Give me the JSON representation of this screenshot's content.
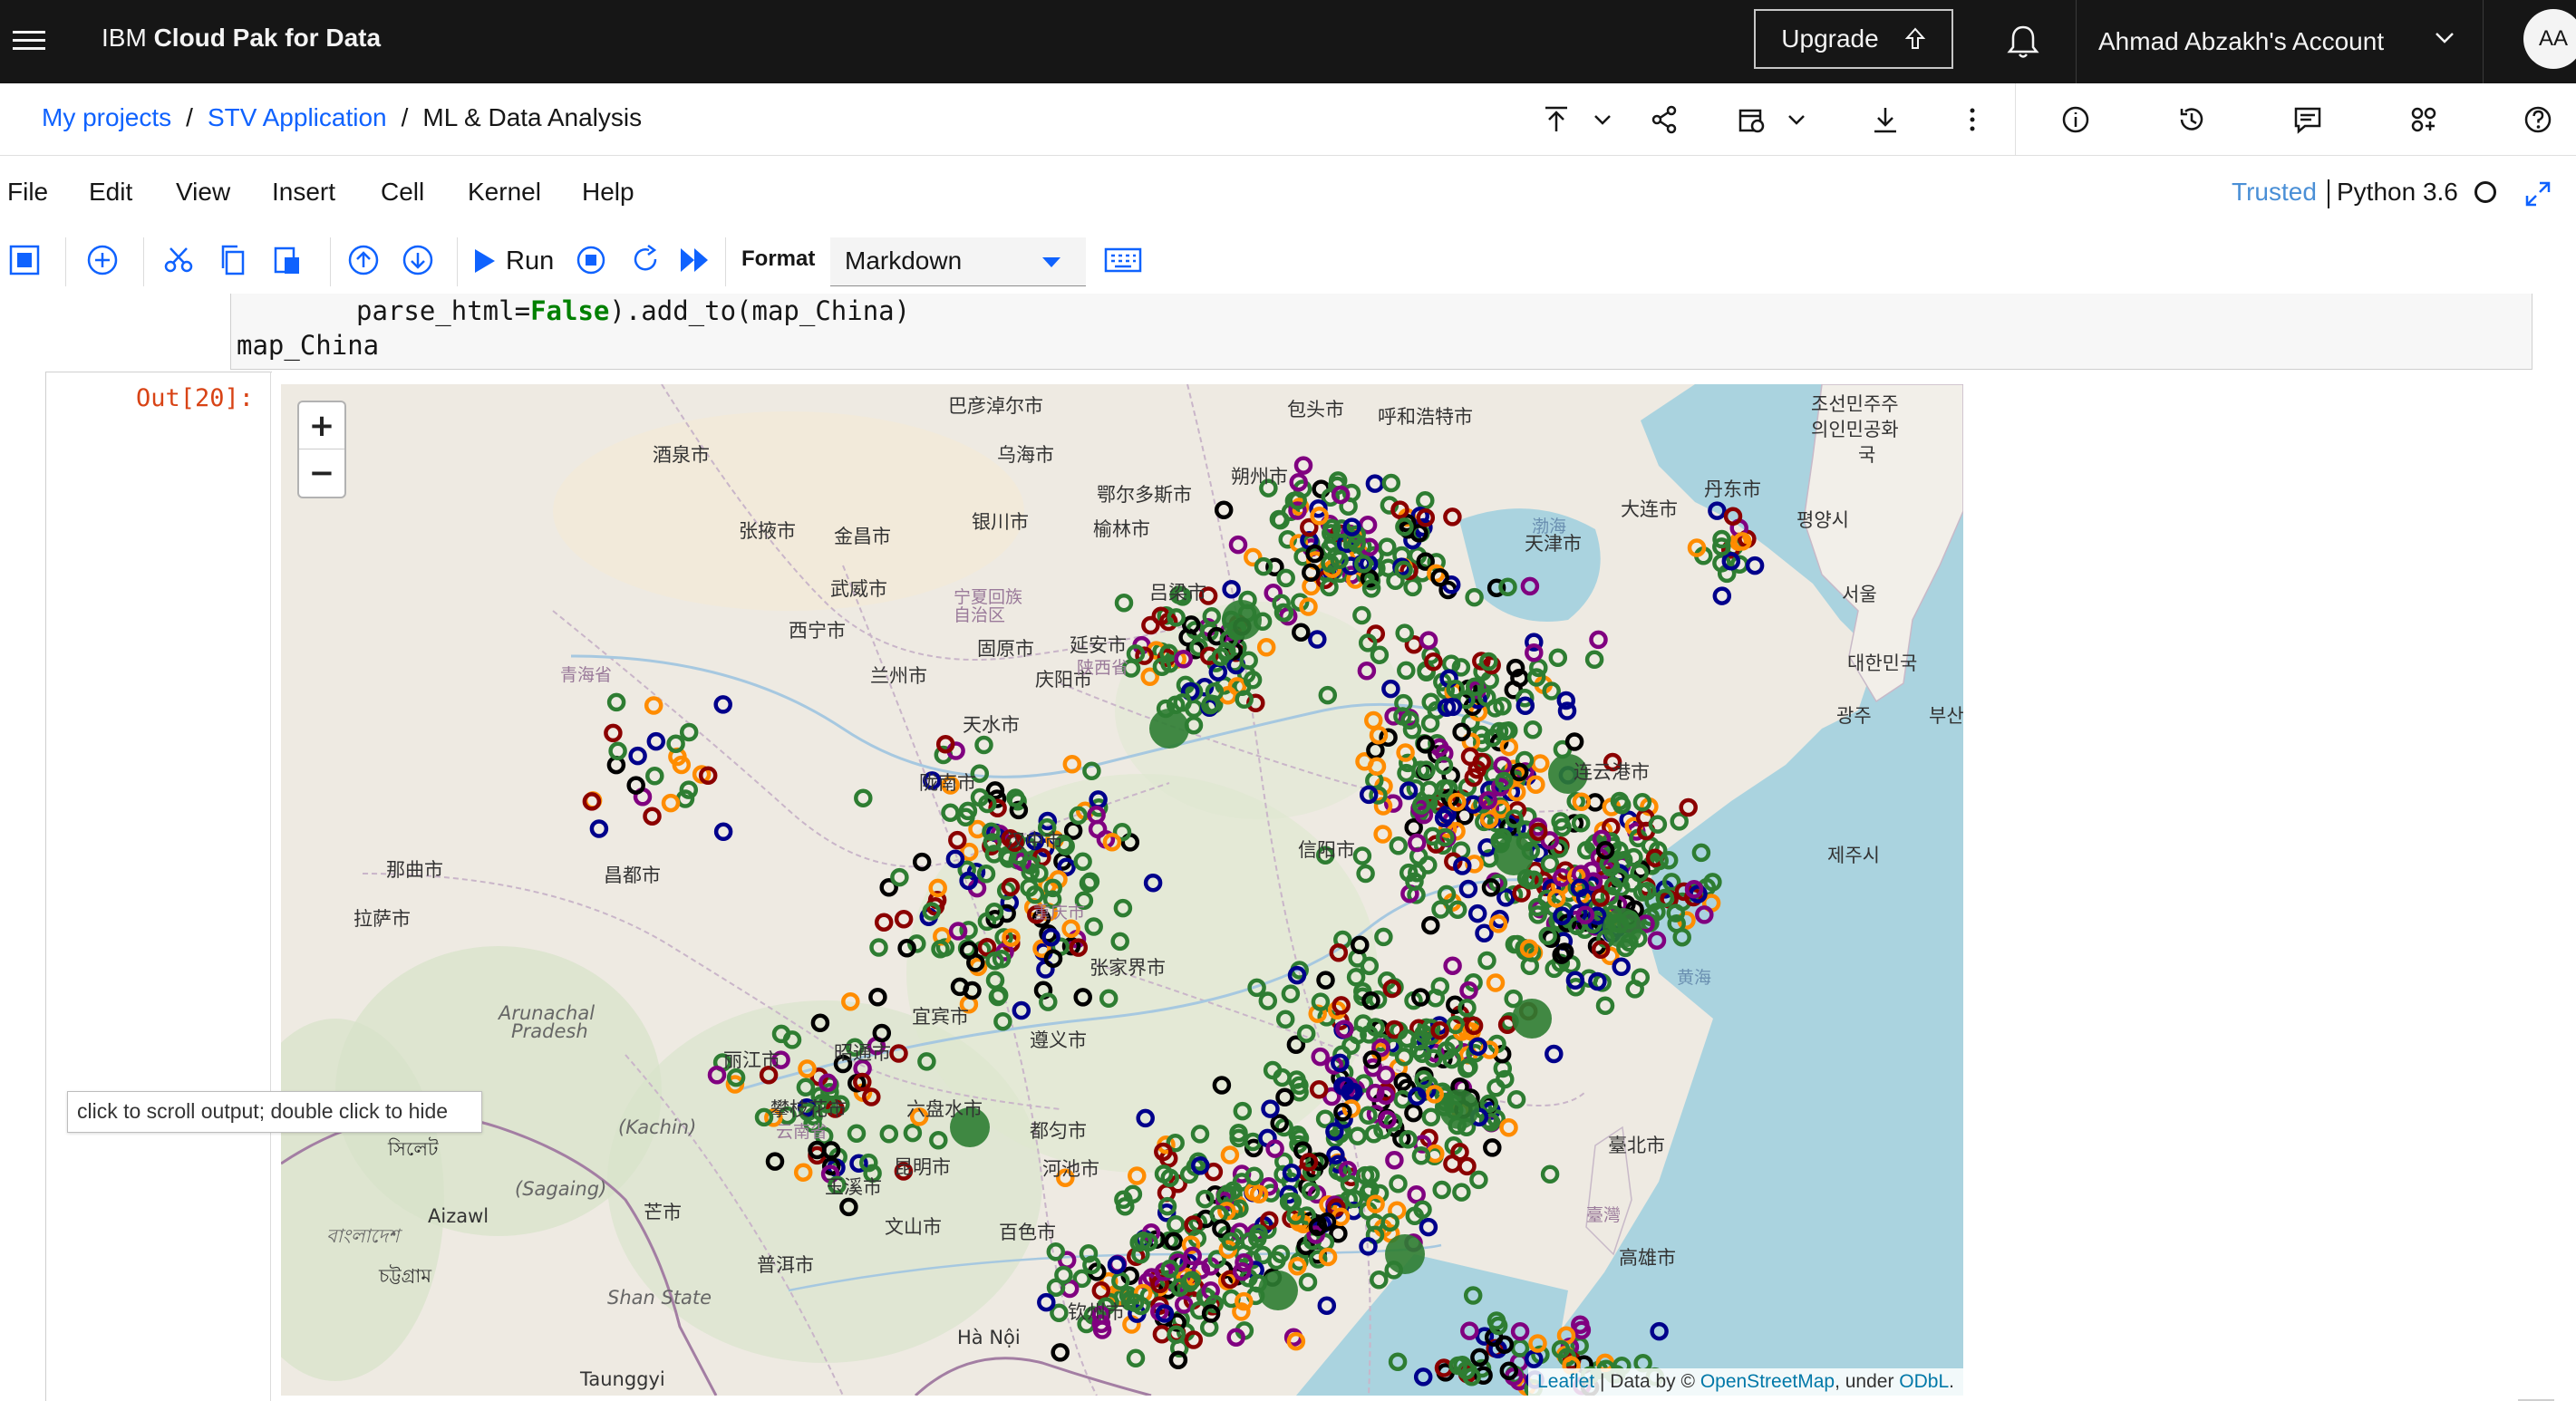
{
  "topbar": {
    "brand_prefix": "IBM ",
    "brand_bold": "Cloud Pak for Data",
    "upgrade_label": "Upgrade",
    "account_label": "Ahmad Abzakh's Account",
    "avatar_initials": "AA"
  },
  "breadcrumb": {
    "items": [
      "My projects",
      "STV Application"
    ],
    "current": "ML & Data Analysis",
    "separator": "/"
  },
  "menubar": {
    "items": [
      "File",
      "Edit",
      "View",
      "Insert",
      "Cell",
      "Kernel",
      "Help"
    ],
    "trusted_label": "Trusted",
    "kernel_label": "Python 3.6"
  },
  "toolbar": {
    "run_label": "Run",
    "format_label": "Format",
    "format_value": "Markdown"
  },
  "code": {
    "line1_a": "parse_html=",
    "line1_kw": "False",
    "line1_b": ").add_to(map_China)",
    "line2": "map_China"
  },
  "output": {
    "prompt": "Out[20]:",
    "tooltip": "click to scroll output; double click to hide"
  },
  "map": {
    "zoom_in": "+",
    "zoom_out": "−",
    "attribution_leaflet": "Leaflet",
    "attribution_mid": " | Data by © ",
    "attribution_osm": "OpenStreetMap",
    "attribution_under": ", under ",
    "attribution_odbl": "ODbL",
    "attribution_end": ".",
    "labels": [
      {
        "text": "巴彦淖尔市",
        "cls": ""
      },
      {
        "text": "包头市",
        "cls": ""
      },
      {
        "text": "呼和浩特市",
        "cls": ""
      },
      {
        "text": "乌海市",
        "cls": ""
      },
      {
        "text": "酒泉市",
        "cls": ""
      },
      {
        "text": "鄂尔多斯市",
        "cls": ""
      },
      {
        "text": "朔州市",
        "cls": ""
      },
      {
        "text": "张掖市",
        "cls": ""
      },
      {
        "text": "金昌市",
        "cls": ""
      },
      {
        "text": "银川市",
        "cls": ""
      },
      {
        "text": "榆林市",
        "cls": ""
      },
      {
        "text": "武威市",
        "cls": ""
      },
      {
        "text": "宁夏回族",
        "cls": "prov"
      },
      {
        "text": "自治区",
        "cls": "prov"
      },
      {
        "text": "吕梁市",
        "cls": ""
      },
      {
        "text": "西宁市",
        "cls": ""
      },
      {
        "text": "固原市",
        "cls": ""
      },
      {
        "text": "延安市",
        "cls": ""
      },
      {
        "text": "青海省",
        "cls": "prov"
      },
      {
        "text": "兰州市",
        "cls": ""
      },
      {
        "text": "庆阳市",
        "cls": ""
      },
      {
        "text": "陕西省",
        "cls": "prov"
      },
      {
        "text": "天水市",
        "cls": ""
      },
      {
        "text": "陇南市",
        "cls": ""
      },
      {
        "text": "汉中市",
        "cls": ""
      },
      {
        "text": "信阳市",
        "cls": ""
      },
      {
        "text": "那曲市",
        "cls": ""
      },
      {
        "text": "昌都市",
        "cls": ""
      },
      {
        "text": "拉萨市",
        "cls": ""
      },
      {
        "text": "重庆市",
        "cls": "prov"
      },
      {
        "text": "张家界市",
        "cls": ""
      },
      {
        "text": "宜宾市",
        "cls": ""
      },
      {
        "text": "遵义市",
        "cls": ""
      },
      {
        "text": "丽江市",
        "cls": ""
      },
      {
        "text": "昭通市",
        "cls": ""
      },
      {
        "text": "攀枝花市",
        "cls": ""
      },
      {
        "text": "六盘水市",
        "cls": ""
      },
      {
        "text": "都匀市",
        "cls": ""
      },
      {
        "text": "云南省",
        "cls": "prov"
      },
      {
        "text": "昆明市",
        "cls": ""
      },
      {
        "text": "河池市",
        "cls": ""
      },
      {
        "text": "玉溪市",
        "cls": ""
      },
      {
        "text": "文山市",
        "cls": ""
      },
      {
        "text": "百色市",
        "cls": ""
      },
      {
        "text": "普洱市",
        "cls": ""
      },
      {
        "text": "钦州市",
        "cls": ""
      },
      {
        "text": "Hà Nội",
        "cls": ""
      },
      {
        "text": "连云港市",
        "cls": ""
      },
      {
        "text": "天津市",
        "cls": ""
      },
      {
        "text": "大连市",
        "cls": ""
      },
      {
        "text": "丹东市",
        "cls": ""
      },
      {
        "text": "渤海",
        "cls": "sea"
      },
      {
        "text": "黄海",
        "cls": "sea"
      },
      {
        "text": "臺北市",
        "cls": ""
      },
      {
        "text": "臺灣",
        "cls": "prov"
      },
      {
        "text": "高雄市",
        "cls": ""
      },
      {
        "text": "조선민주주",
        "cls": ""
      },
      {
        "text": "의인민공화",
        "cls": ""
      },
      {
        "text": "국",
        "cls": ""
      },
      {
        "text": "평양시",
        "cls": ""
      },
      {
        "text": "서울",
        "cls": ""
      },
      {
        "text": "대한민국",
        "cls": ""
      },
      {
        "text": "광주",
        "cls": ""
      },
      {
        "text": "부산",
        "cls": ""
      },
      {
        "text": "제주시",
        "cls": ""
      },
      {
        "text": "Arunachal",
        "cls": "it"
      },
      {
        "text": "Pradesh",
        "cls": "it"
      },
      {
        "text": "(Kachin)",
        "cls": "it"
      },
      {
        "text": "(Sagaing)",
        "cls": "it"
      },
      {
        "text": "Shan State",
        "cls": "it"
      },
      {
        "text": "Aizawl",
        "cls": ""
      },
      {
        "text": "Taunggyi",
        "cls": ""
      },
      {
        "text": "সিলেট",
        "cls": ""
      },
      {
        "text": "বাংলাদেশ",
        "cls": "it"
      },
      {
        "text": "চট্টগ্রাম",
        "cls": ""
      },
      {
        "text": "芒市",
        "cls": ""
      }
    ],
    "marker_colors": [
      "#2e7d32",
      "#2e7d32",
      "#2e7d32",
      "#2e7d32",
      "#000000",
      "#00008b",
      "#8b0000",
      "#ff8c00",
      "#800080"
    ]
  }
}
